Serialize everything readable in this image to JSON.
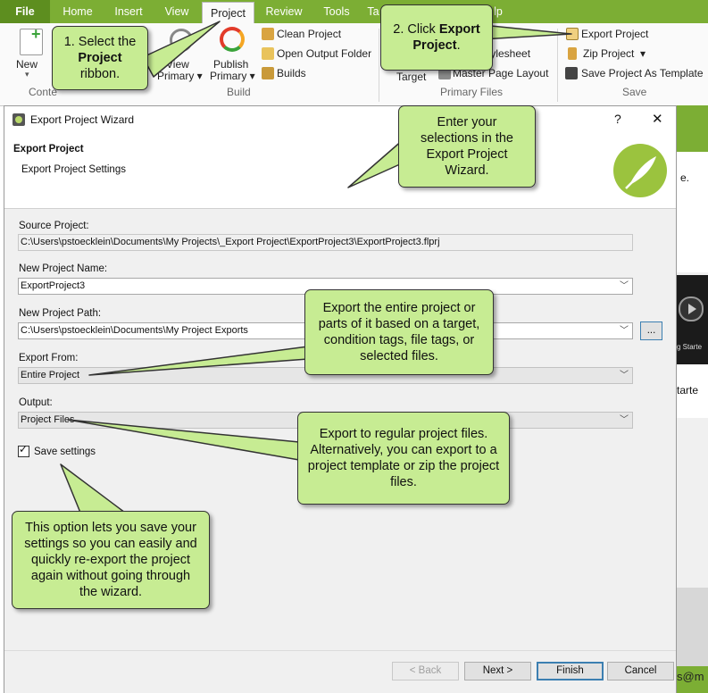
{
  "ribbon": {
    "tabs": [
      "File",
      "Home",
      "Insert",
      "View",
      "Project",
      "Review",
      "Tools",
      "Ta",
      "lp"
    ],
    "active_tab": "Project",
    "new_label": "New",
    "content_label": "Conte",
    "view_primary": "View Primary",
    "publish_primary": "Publish Primary",
    "build_group": "Build",
    "clean_project": "Clean Project",
    "open_output_folder": "Open Output Folder",
    "builds": "Builds",
    "target": "Target",
    "stylesheet": "tylesheet",
    "master_page_layout": "Master Page Layout",
    "primary_files_group": "Primary Files",
    "export_project": "Export Project",
    "zip_project": "Zip Project",
    "save_as_template": "Save Project As Template",
    "save_group": "Save"
  },
  "dialog": {
    "title": "Export Project Wizard",
    "help": "?",
    "close": "✕",
    "heading": "Export Project",
    "subheading": "Export Project Settings",
    "source_label": "Source Project:",
    "source_value": "C:\\Users\\pstoecklein\\Documents\\My Projects\\_Export Project\\ExportProject3\\ExportProject3.flprj",
    "name_label": "New Project Name:",
    "name_value": "ExportProject3",
    "path_label": "New Project Path:",
    "path_value": "C:\\Users\\pstoecklein\\Documents\\My Project Exports",
    "browse": "...",
    "export_from_label": "Export From:",
    "export_from_value": "Entire Project",
    "output_label": "Output:",
    "output_value": "Project Files",
    "save_settings_label": "Save settings",
    "save_settings_checked": true,
    "back": "< Back",
    "next": "Next >",
    "finish": "Finish",
    "cancel": "Cancel"
  },
  "background_fragments": {
    "period": "e.",
    "gstarted": "g Starte",
    "started": "tarte",
    "email": "s@m"
  },
  "callouts": {
    "select_ribbon": [
      "1. Select the",
      "Project",
      "ribbon."
    ],
    "click_export": [
      "2. Click ",
      "Export",
      "Project",
      "."
    ],
    "enter_selections": "Enter your selections in the Export Project Wizard.",
    "export_from_tip": "Export the entire project or parts of it based on a target, condition tags, file tags, or selected files.",
    "output_tip": "Export to regular project files. Alternatively, you can export to a project template or zip the project files.",
    "save_tip": "This option lets you save your settings so you can easily and quickly re-export the project again without going through the wizard."
  },
  "colors": {
    "accent_green": "#7cae34",
    "callout_fill": "#c7ec93",
    "dialog_bg": "#f0f0f0"
  }
}
